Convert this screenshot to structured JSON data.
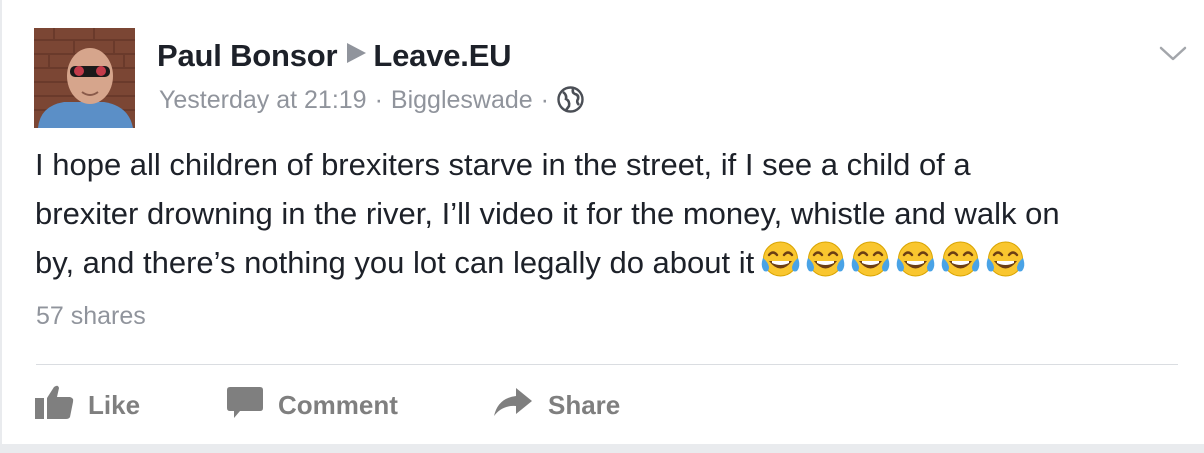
{
  "post": {
    "author": "Paul Bonsor",
    "target_page": "Leave.EU",
    "timestamp": "Yesterday at 21:19",
    "location": "Biggleswade",
    "privacy_icon": "globe-icon",
    "text_lines": [
      "I hope all children of brexiters starve in the street, if I see a child of a",
      "brexiter drowning in the river, I’ll video it for the money, whistle and walk on",
      "by, and there’s nothing you lot can legally do about it"
    ],
    "emoji_name": "face-with-tears-of-joy",
    "emoji_count": 6,
    "shares": "57 shares"
  },
  "actions": {
    "like_label": "Like",
    "comment_label": "Comment",
    "share_label": "Share"
  },
  "colors": {
    "text": "#1d2129",
    "meta": "#90949c",
    "action": "#7f7f7f",
    "emoji_face": "#f9c62f"
  }
}
